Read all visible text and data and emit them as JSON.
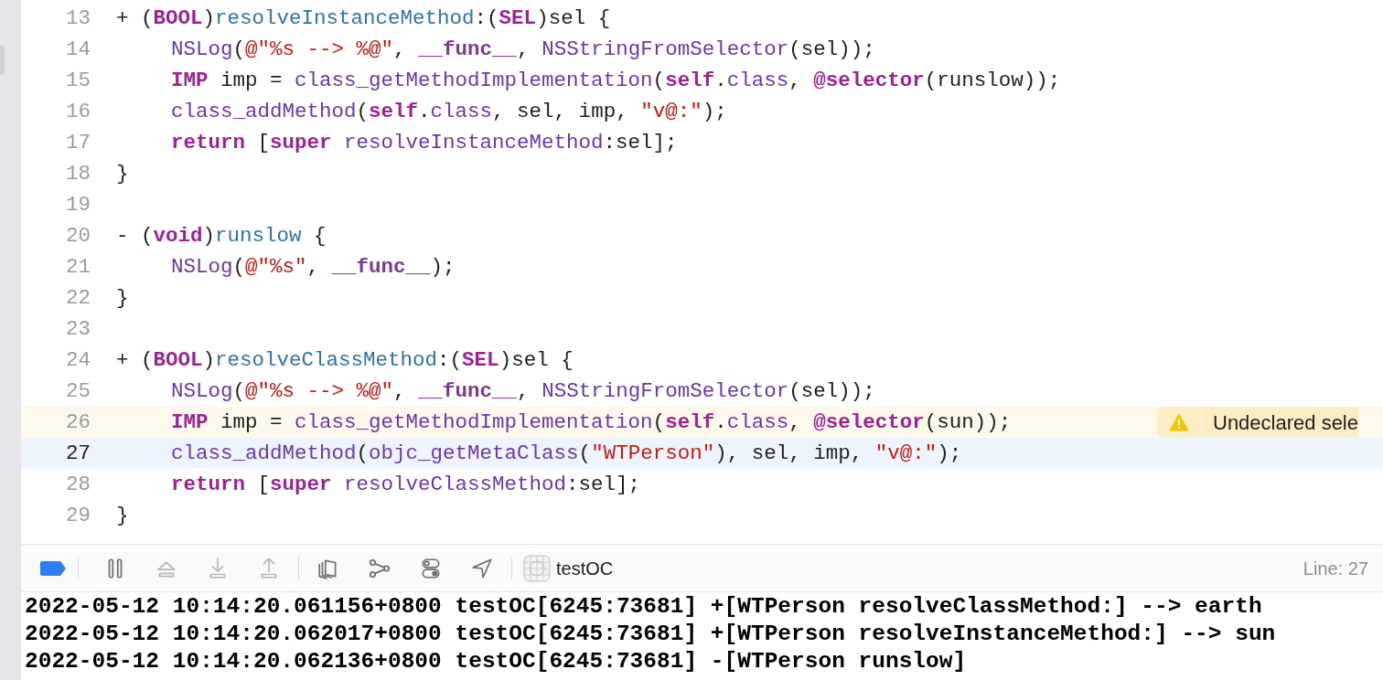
{
  "editor": {
    "lines": [
      {
        "number": "13",
        "tokens": [
          {
            "kind": "plain",
            "text": "+ ("
          },
          {
            "kind": "keyword",
            "text": "BOOL"
          },
          {
            "kind": "plain",
            "text": ")"
          },
          {
            "kind": "declaration",
            "text": "resolveInstanceMethod"
          },
          {
            "kind": "plain",
            "text": ":("
          },
          {
            "kind": "keyword",
            "text": "SEL"
          },
          {
            "kind": "plain",
            "text": ")sel {"
          }
        ]
      },
      {
        "number": "14",
        "indented": true,
        "tokens": [
          {
            "kind": "function",
            "text": "NSLog"
          },
          {
            "kind": "plain",
            "text": "("
          },
          {
            "kind": "string",
            "text": "@\"%s --> %@\""
          },
          {
            "kind": "plain",
            "text": ", "
          },
          {
            "kind": "macro",
            "text": "__func__"
          },
          {
            "kind": "plain",
            "text": ", "
          },
          {
            "kind": "function",
            "text": "NSStringFromSelector"
          },
          {
            "kind": "plain",
            "text": "(sel));"
          }
        ]
      },
      {
        "number": "15",
        "indented": true,
        "tokens": [
          {
            "kind": "keyword",
            "text": "IMP"
          },
          {
            "kind": "plain",
            "text": " imp = "
          },
          {
            "kind": "function",
            "text": "class_getMethodImplementation"
          },
          {
            "kind": "plain",
            "text": "("
          },
          {
            "kind": "keyword",
            "text": "self"
          },
          {
            "kind": "plain",
            "text": "."
          },
          {
            "kind": "function",
            "text": "class"
          },
          {
            "kind": "plain",
            "text": ", "
          },
          {
            "kind": "keyword",
            "text": "@selector"
          },
          {
            "kind": "plain",
            "text": "(runslow));"
          }
        ]
      },
      {
        "number": "16",
        "indented": true,
        "tokens": [
          {
            "kind": "function",
            "text": "class_addMethod"
          },
          {
            "kind": "plain",
            "text": "("
          },
          {
            "kind": "keyword",
            "text": "self"
          },
          {
            "kind": "plain",
            "text": "."
          },
          {
            "kind": "function",
            "text": "class"
          },
          {
            "kind": "plain",
            "text": ", sel, imp, "
          },
          {
            "kind": "string",
            "text": "\"v@:\""
          },
          {
            "kind": "plain",
            "text": ");"
          }
        ]
      },
      {
        "number": "17",
        "indented": true,
        "tokens": [
          {
            "kind": "keyword",
            "text": "return"
          },
          {
            "kind": "plain",
            "text": " ["
          },
          {
            "kind": "keyword",
            "text": "super"
          },
          {
            "kind": "function",
            "text": " resolveInstanceMethod"
          },
          {
            "kind": "plain",
            "text": ":sel];"
          }
        ]
      },
      {
        "number": "18",
        "tokens": [
          {
            "kind": "plain",
            "text": "}"
          }
        ]
      },
      {
        "number": "19"
      },
      {
        "number": "20",
        "tokens": [
          {
            "kind": "plain",
            "text": "- ("
          },
          {
            "kind": "keyword",
            "text": "void"
          },
          {
            "kind": "plain",
            "text": ")"
          },
          {
            "kind": "declaration",
            "text": "runslow"
          },
          {
            "kind": "plain",
            "text": " {"
          }
        ]
      },
      {
        "number": "21",
        "indented": true,
        "tokens": [
          {
            "kind": "function",
            "text": "NSLog"
          },
          {
            "kind": "plain",
            "text": "("
          },
          {
            "kind": "string",
            "text": "@\"%s\""
          },
          {
            "kind": "plain",
            "text": ", "
          },
          {
            "kind": "macro",
            "text": "__func__"
          },
          {
            "kind": "plain",
            "text": ");"
          }
        ]
      },
      {
        "number": "22",
        "tokens": [
          {
            "kind": "plain",
            "text": "}"
          }
        ]
      },
      {
        "number": "23"
      },
      {
        "number": "24",
        "tokens": [
          {
            "kind": "plain",
            "text": "+ ("
          },
          {
            "kind": "keyword",
            "text": "BOOL"
          },
          {
            "kind": "plain",
            "text": ")"
          },
          {
            "kind": "declaration",
            "text": "resolveClassMethod"
          },
          {
            "kind": "plain",
            "text": ":("
          },
          {
            "kind": "keyword",
            "text": "SEL"
          },
          {
            "kind": "plain",
            "text": ")sel {"
          }
        ]
      },
      {
        "number": "25",
        "indented": true,
        "tokens": [
          {
            "kind": "function",
            "text": "NSLog"
          },
          {
            "kind": "plain",
            "text": "("
          },
          {
            "kind": "string",
            "text": "@\"%s --> %@\""
          },
          {
            "kind": "plain",
            "text": ", "
          },
          {
            "kind": "macro",
            "text": "__func__"
          },
          {
            "kind": "plain",
            "text": ", "
          },
          {
            "kind": "function",
            "text": "NSStringFromSelector"
          },
          {
            "kind": "plain",
            "text": "(sel));"
          }
        ]
      },
      {
        "number": "26",
        "indented": true,
        "warning": "Undeclared sele",
        "tokens": [
          {
            "kind": "keyword",
            "text": "IMP"
          },
          {
            "kind": "plain",
            "text": " imp = "
          },
          {
            "kind": "function",
            "text": "class_getMethodImplementation"
          },
          {
            "kind": "plain",
            "text": "("
          },
          {
            "kind": "keyword",
            "text": "self"
          },
          {
            "kind": "plain",
            "text": "."
          },
          {
            "kind": "function",
            "text": "class"
          },
          {
            "kind": "plain",
            "text": ", "
          },
          {
            "kind": "keyword",
            "text": "@selector"
          },
          {
            "kind": "plain",
            "text": "(sun));"
          }
        ]
      },
      {
        "number": "27",
        "indented": true,
        "current": true,
        "tokens": [
          {
            "kind": "function",
            "text": "class_addMethod"
          },
          {
            "kind": "plain",
            "text": "("
          },
          {
            "kind": "function",
            "text": "objc_getMetaClass"
          },
          {
            "kind": "plain",
            "text": "("
          },
          {
            "kind": "string",
            "text": "\"WTPerson\""
          },
          {
            "kind": "plain",
            "text": "), sel, imp, "
          },
          {
            "kind": "string",
            "text": "\"v@:\""
          },
          {
            "kind": "plain",
            "text": ");"
          }
        ]
      },
      {
        "number": "28",
        "indented": true,
        "tokens": [
          {
            "kind": "keyword",
            "text": "return"
          },
          {
            "kind": "plain",
            "text": " ["
          },
          {
            "kind": "keyword",
            "text": "super"
          },
          {
            "kind": "function",
            "text": " resolveClassMethod"
          },
          {
            "kind": "plain",
            "text": ":sel];"
          }
        ]
      },
      {
        "number": "29",
        "tokens": [
          {
            "kind": "plain",
            "text": "}"
          }
        ]
      }
    ]
  },
  "debug_bar": {
    "breakpoints_button": {
      "on": true
    },
    "buttons": [
      {
        "kind": "pause",
        "disabled": false
      },
      {
        "kind": "step-over",
        "disabled": true
      },
      {
        "kind": "step-in",
        "disabled": true
      },
      {
        "kind": "step-out",
        "disabled": true
      },
      {
        "kind": "view-debugger",
        "disabled": false
      },
      {
        "kind": "memory-graph",
        "disabled": false
      },
      {
        "kind": "environment",
        "disabled": false
      },
      {
        "kind": "location",
        "disabled": false
      }
    ],
    "process": "testOC",
    "cursor": "Line: 27"
  },
  "console": {
    "lines": [
      "2022-05-12 10:14:20.061156+0800 testOC[6245:73681] +[WTPerson resolveClassMethod:] --> earth",
      "2022-05-12 10:14:20.062017+0800 testOC[6245:73681] +[WTPerson resolveInstanceMethod:] --> sun",
      "2022-05-12 10:14:20.062136+0800 testOC[6245:73681] -[WTPerson runslow]"
    ]
  }
}
